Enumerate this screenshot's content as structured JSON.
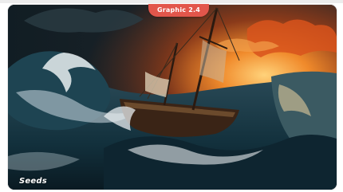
{
  "badge": {
    "label": "Graphic 2.4",
    "color": "#e2564b"
  },
  "logo": {
    "text": "Seeds"
  },
  "image": {
    "subject": "sailing-ship-in-stormy-sea"
  },
  "colors": {
    "sky_fire": "#e8641e",
    "sea_dark": "#12303c",
    "foam": "#e9eef0"
  }
}
